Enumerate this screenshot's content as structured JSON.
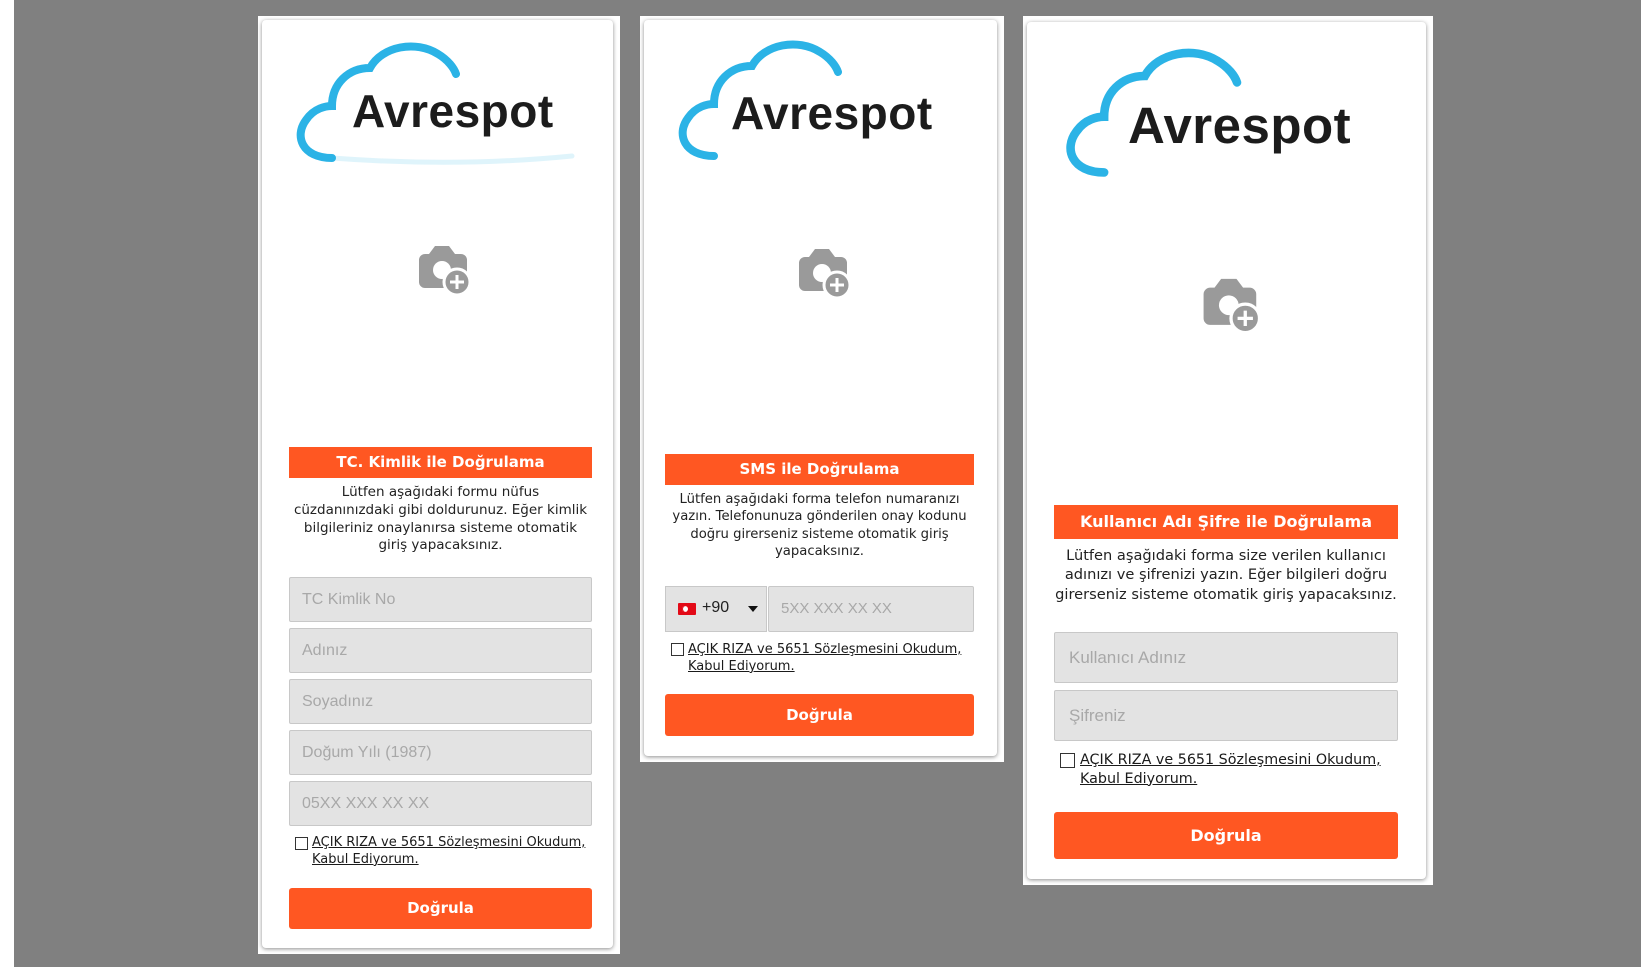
{
  "brand": {
    "name": "Avrespot",
    "cloud_color": "#2bb3e6",
    "accent_color": "#ff5722",
    "background_color": "#808080"
  },
  "forms": {
    "tc": {
      "title": "TC. Kimlik ile Doğrulama",
      "description": "Lütfen aşağıdaki formu nüfus cüzdanınızdaki gibi doldurunuz. Eğer kimlik bilgileriniz onaylanırsa sisteme otomatik giriş yapacaksınız.",
      "fields": [
        {
          "placeholder": "TC Kimlik No"
        },
        {
          "placeholder": "Adınız"
        },
        {
          "placeholder": "Soyadınız"
        },
        {
          "placeholder": "Doğum Yılı (1987)"
        },
        {
          "placeholder": "05XX XXX XX XX"
        }
      ],
      "agreement": "AÇIK RIZA ve 5651 Sözleşmesini Okudum, Kabul Ediyorum.",
      "agreement_checked": false,
      "submit_label": "Doğrula"
    },
    "sms": {
      "title": "SMS ile Doğrulama",
      "description": "Lütfen aşağıdaki forma telefon numaranızı yazın. Telefonunuza gönderilen onay kodunu doğru girerseniz sisteme otomatik giriş yapacaksınız.",
      "country_code": "+90",
      "country_flag": "turkey-flag-icon",
      "phone_placeholder": "5XX XXX XX XX",
      "agreement": "AÇIK RIZA ve 5651 Sözleşmesini Okudum, Kabul Ediyorum.",
      "agreement_checked": false,
      "submit_label": "Doğrula"
    },
    "userpass": {
      "title": "Kullanıcı Adı Şifre ile Doğrulama",
      "description": "Lütfen aşağıdaki forma size verilen kullanıcı adınızı ve şifrenizi yazın. Eğer bilgileri doğru girerseniz sisteme otomatik giriş yapacaksınız.",
      "username_placeholder": "Kullanıcı Adınız",
      "password_placeholder": "Şifreniz",
      "agreement": "AÇIK RIZA ve 5651 Sözleşmesini Okudum, Kabul Ediyorum.",
      "agreement_checked": false,
      "submit_label": "Doğrula"
    }
  },
  "icons": {
    "image_placeholder": "add-photo-icon"
  }
}
